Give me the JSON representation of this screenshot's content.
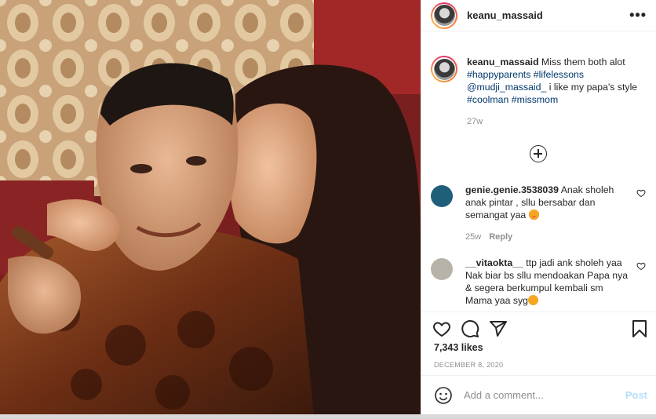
{
  "post": {
    "username": "keanu_massaid",
    "more_label": "•••",
    "caption": {
      "username": "keanu_massaid",
      "text_1": " Miss them both alot ",
      "tag_1": "#happyparents",
      "text_2": " ",
      "tag_2": "#lifelessons",
      "text_3": " ",
      "tag_3": "@mudji_massaid_",
      "text_4": " i like my papa's style ",
      "tag_4": "#coolman",
      "text_5": " ",
      "tag_5": "#missmom",
      "time": "27w"
    },
    "comments": [
      {
        "username": "genie.genie.3538039",
        "text": " Anak sholeh anak pintar , sllu bersabar dan semangat yaa ",
        "time": "25w",
        "reply_label": "Reply",
        "avatar_color": "#1f5f7a"
      },
      {
        "username": "__vitaokta__",
        "text": " ttp jadi ank sholeh yaa Nak biar bs sllu mendoakan Papa nya & segera berkumpul kembali sm Mama yaa syg",
        "time": "",
        "reply_label": "",
        "avatar_color": "#b7b3a8"
      }
    ],
    "likes": "7,343 likes",
    "date": "DECEMBER 8, 2020",
    "add_comment_placeholder": "Add a comment...",
    "post_button": "Post",
    "icons": [
      "heart-icon",
      "comment-icon",
      "share-icon",
      "bookmark-icon",
      "emoji-icon",
      "plus-circle-icon"
    ]
  }
}
